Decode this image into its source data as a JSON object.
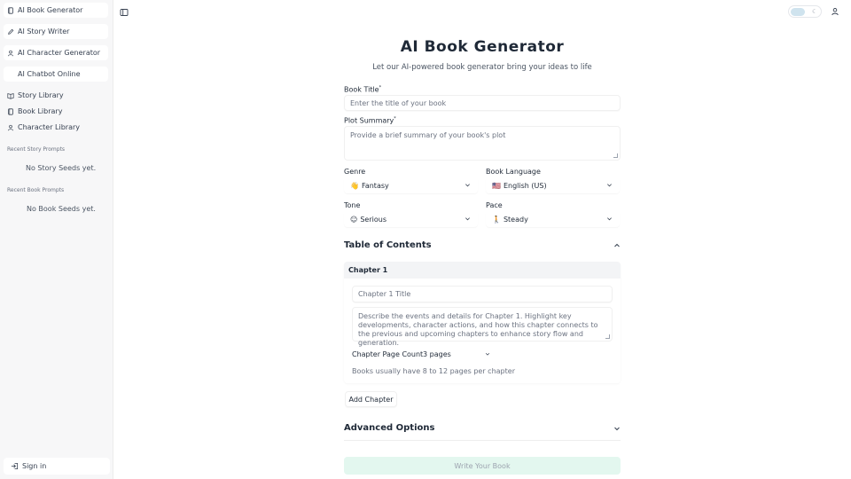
{
  "sidebar": {
    "items": [
      {
        "label": "AI Book Generator",
        "icon": "book-icon"
      },
      {
        "label": "AI Story Writer",
        "icon": "pen-icon"
      },
      {
        "label": "AI Character Generator",
        "icon": "person-icon"
      },
      {
        "label": "AI Chatbot Online",
        "icon": ""
      },
      {
        "label": "Story Library",
        "icon": "open-book-icon"
      },
      {
        "label": "Book Library",
        "icon": "book-icon"
      },
      {
        "label": "Character Library",
        "icon": "person-icon"
      }
    ],
    "recent_story_heading": "Recent Story Prompts",
    "recent_story_empty": "No Story Seeds yet.",
    "recent_book_heading": "Recent Book Prompts",
    "recent_book_empty": "No Book Seeds yet.",
    "signin_label": "Sign in"
  },
  "topbar": {
    "sidebar_toggle_icon": "sidebar-toggle-icon",
    "theme_toggle_icon": "moon-icon",
    "user_icon": "user-icon"
  },
  "main": {
    "title": "AI Book Generator",
    "subtitle": "Let our AI-powered book generator bring your ideas to life",
    "book_title": {
      "label": "Book Title",
      "required_mark": "*",
      "placeholder": "Enter the title of your book"
    },
    "plot_summary": {
      "label": "Plot Summary",
      "required_mark": "*",
      "placeholder": "Provide a brief summary of your book's plot"
    },
    "genre": {
      "label": "Genre",
      "emoji": "👋",
      "value": "Fantasy"
    },
    "language": {
      "label": "Book Language",
      "emoji": "🇺🇸",
      "value": "English (US)"
    },
    "tone": {
      "label": "Tone",
      "emoji": "☺",
      "value": "Serious"
    },
    "pace": {
      "label": "Pace",
      "emoji": "🚶",
      "value": "Steady"
    },
    "toc": {
      "heading": "Table of Contents",
      "chapter_heading": "Chapter 1",
      "chapter_title_placeholder": "Chapter 1 Title",
      "chapter_desc_placeholder": "Describe the events and details for Chapter 1. Highlight key developments, character actions, and how this chapter connects to the previous and upcoming chapters to enhance story flow and generation.",
      "page_count_label": "Chapter Page Count",
      "page_count_value": "3 pages",
      "hint": "Books usually have 8 to 12 pages per chapter",
      "add_chapter_label": "Add Chapter"
    },
    "advanced_heading": "Advanced Options",
    "write_button": "Write Your Book"
  },
  "colors": {
    "sidebar_bg": "#f7f7f8",
    "write_button_bg": "#e3f7ef",
    "toggle_knob": "#cfe3ee"
  }
}
